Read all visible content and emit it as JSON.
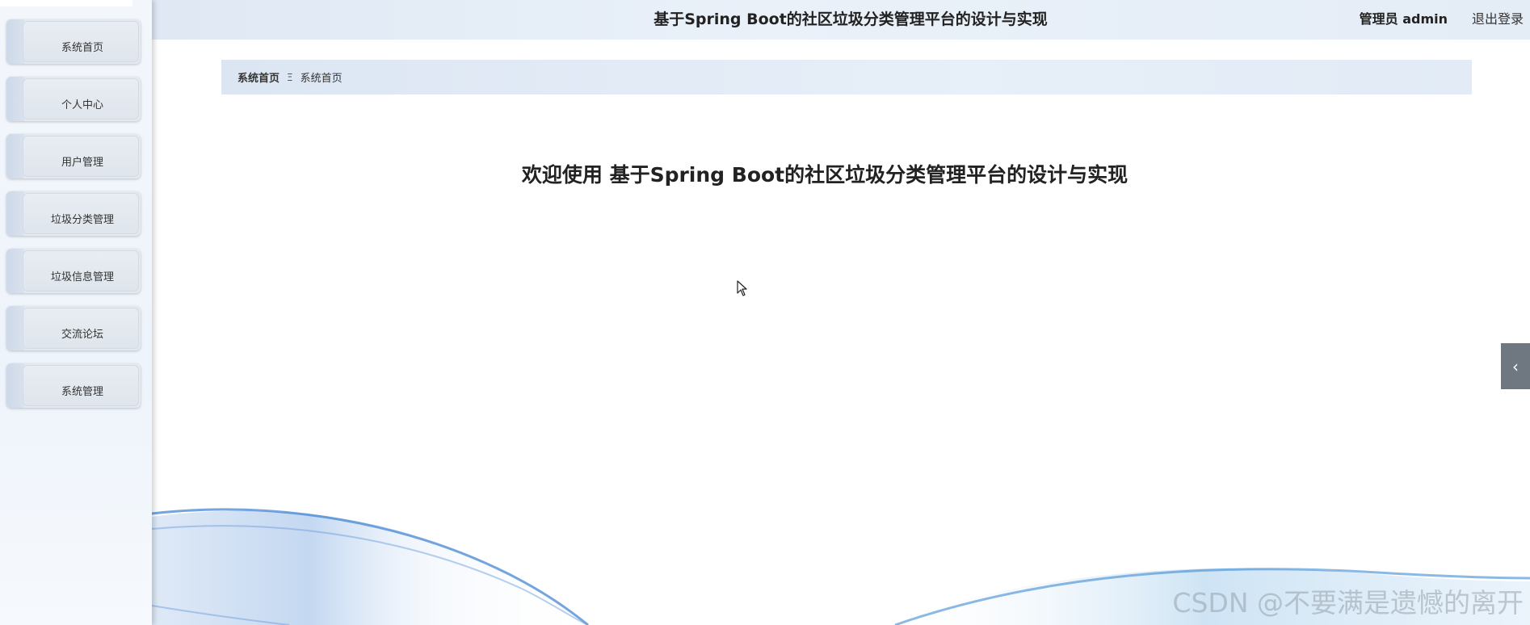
{
  "header": {
    "title": "基于Spring Boot的社区垃圾分类管理平台的设计与实现",
    "user": "管理员 admin",
    "logout": "退出登录"
  },
  "sidebar": {
    "items": [
      {
        "label": "系统首页"
      },
      {
        "label": "个人中心"
      },
      {
        "label": "用户管理"
      },
      {
        "label": "垃圾分类管理"
      },
      {
        "label": "垃圾信息管理"
      },
      {
        "label": "交流论坛"
      },
      {
        "label": "系统管理"
      }
    ]
  },
  "breadcrumb": {
    "home": "系统首页",
    "separator": "Ξ",
    "current": "系统首页"
  },
  "main": {
    "welcome": "欢迎使用 基于Spring Boot的社区垃圾分类管理平台的设计与实现"
  },
  "collapse_tab": {
    "icon": "chevron-left-icon",
    "glyph": "‹"
  },
  "watermark": {
    "text": "CSDN @不要满是遗憾的离开"
  },
  "colors": {
    "header_bg": "#e4ecf6",
    "sidebar_bg": "#eef4fb",
    "menu_item_bg": "#e4e9f0",
    "collapse_tab_bg": "#6f7780",
    "wave_blue": "#3a7fd0"
  }
}
